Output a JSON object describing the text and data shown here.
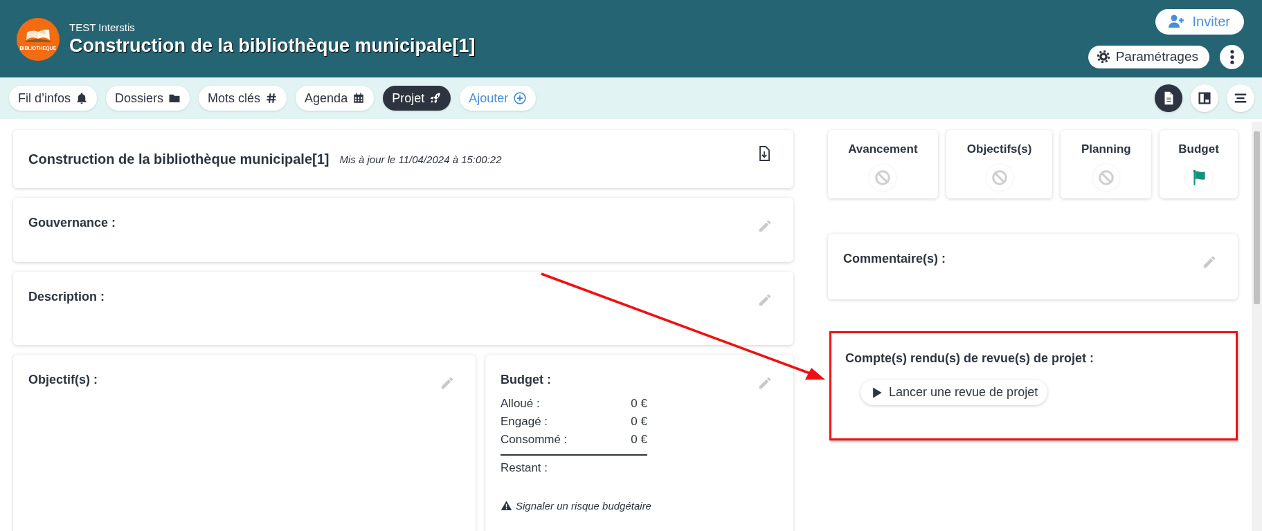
{
  "header": {
    "org": "TEST Interstis",
    "title": "Construction de la bibliothèque municipale[1]",
    "logo_text": "BIBLIOTHEQUE",
    "buttons": [
      {
        "kind": "invite",
        "label": "Inviter"
      },
      {
        "kind": "settings",
        "label": "Paramétrages"
      },
      {
        "kind": "more"
      }
    ]
  },
  "nav": {
    "tabs": [
      {
        "kind": "news",
        "label": "Fil d’infos",
        "selected": false
      },
      {
        "kind": "folders",
        "label": "Dossiers",
        "selected": false
      },
      {
        "kind": "keywords",
        "label": "Mots clés",
        "selected": false
      },
      {
        "kind": "agenda",
        "label": "Agenda",
        "selected": false
      },
      {
        "kind": "project",
        "label": "Projet",
        "selected": true
      },
      {
        "kind": "add",
        "label": "Ajouter",
        "selected": false
      }
    ],
    "views": [
      {
        "kind": "document",
        "selected": true
      },
      {
        "kind": "board",
        "selected": false
      },
      {
        "kind": "list",
        "selected": false
      }
    ]
  },
  "project": {
    "title": "Construction de la bibliothèque municipale[1]",
    "updated": "Mis à jour le 11/04/2024 à 15:00:22"
  },
  "sections": [
    {
      "label": "Gouvernance :"
    },
    {
      "label": "Description :"
    }
  ],
  "objectives": {
    "label": "Objectif(s) :"
  },
  "budget": {
    "label": "Budget :",
    "rows": [
      {
        "label": "Alloué :",
        "value": "0 €"
      },
      {
        "label": "Engagé :",
        "value": "0 €"
      },
      {
        "label": "Consommé :",
        "value": "0 €"
      }
    ],
    "remaining": "Restant :",
    "risk_link": "Signaler un risque budgétaire"
  },
  "indicators": [
    {
      "label": "Avancement",
      "kind": "none"
    },
    {
      "label": "Objectifs(s)",
      "kind": "none"
    },
    {
      "label": "Planning",
      "kind": "none"
    },
    {
      "label": "Budget",
      "kind": "flag"
    }
  ],
  "comments": {
    "label": "Commentaire(s) :"
  },
  "reviews": {
    "label": "Compte(s) rendu(s) de revue(s) de projet :",
    "button": "Lancer une revue de projet",
    "highlighted": true
  }
}
